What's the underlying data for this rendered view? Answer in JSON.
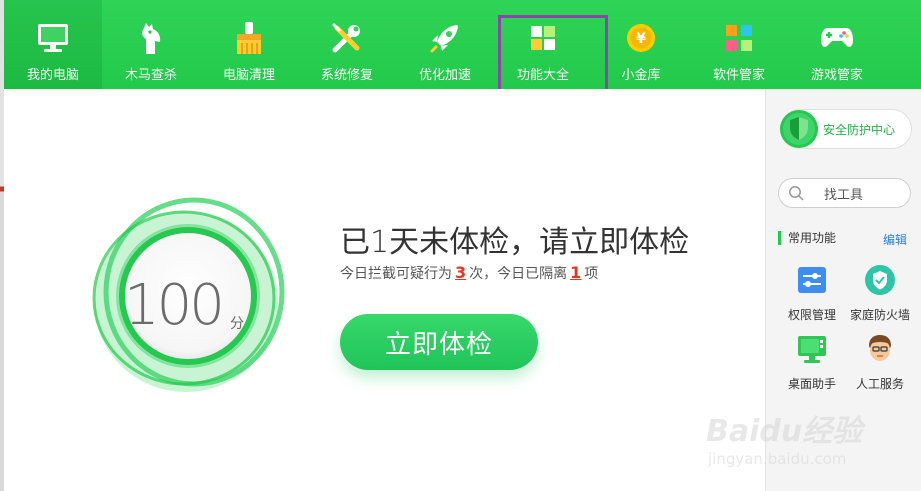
{
  "nav": {
    "items": [
      {
        "label": "我的电脑",
        "icon": "monitor-icon"
      },
      {
        "label": "木马查杀",
        "icon": "trojan-horse-icon"
      },
      {
        "label": "电脑清理",
        "icon": "broom-icon"
      },
      {
        "label": "系统修复",
        "icon": "wrench-screwdriver-icon"
      },
      {
        "label": "优化加速",
        "icon": "rocket-icon"
      },
      {
        "label": "功能大全",
        "icon": "grid-tiles-icon"
      },
      {
        "label": "小金库",
        "icon": "gold-coin-icon"
      },
      {
        "label": "软件管家",
        "icon": "software-petals-icon"
      },
      {
        "label": "游戏管家",
        "icon": "gamepad-icon"
      }
    ],
    "active_index": 0,
    "highlighted_index": 5
  },
  "main": {
    "score": "100",
    "score_unit": "分",
    "headline": "已1天未体检，请立即体检",
    "subline": {
      "prefix": "今日拦截可疑行为",
      "blocked_count": "3",
      "middle": "次，今日已隔离",
      "quarantined_count": "1",
      "suffix": "项"
    },
    "scan_button": "立即体检"
  },
  "sidebar": {
    "protect_center": "安全防护中心",
    "search_label": "找工具",
    "common_title": "常用功能",
    "edit_label": "编辑",
    "tools": [
      {
        "label": "权限管理",
        "icon": "permission-sliders-icon"
      },
      {
        "label": "家庭防火墙",
        "icon": "shield-check-icon"
      },
      {
        "label": "桌面助手",
        "icon": "desktop-assistant-icon"
      },
      {
        "label": "人工服务",
        "icon": "agent-avatar-icon"
      }
    ]
  },
  "watermark": {
    "brand": "Baidu经验",
    "url": "jingyan.baidu.com"
  },
  "colors": {
    "nav_green": "#22c94a",
    "accent_green": "#20c458",
    "highlight_purple": "#8e44ad",
    "number_red": "#e6361c",
    "link_blue": "#2a7ed8"
  }
}
